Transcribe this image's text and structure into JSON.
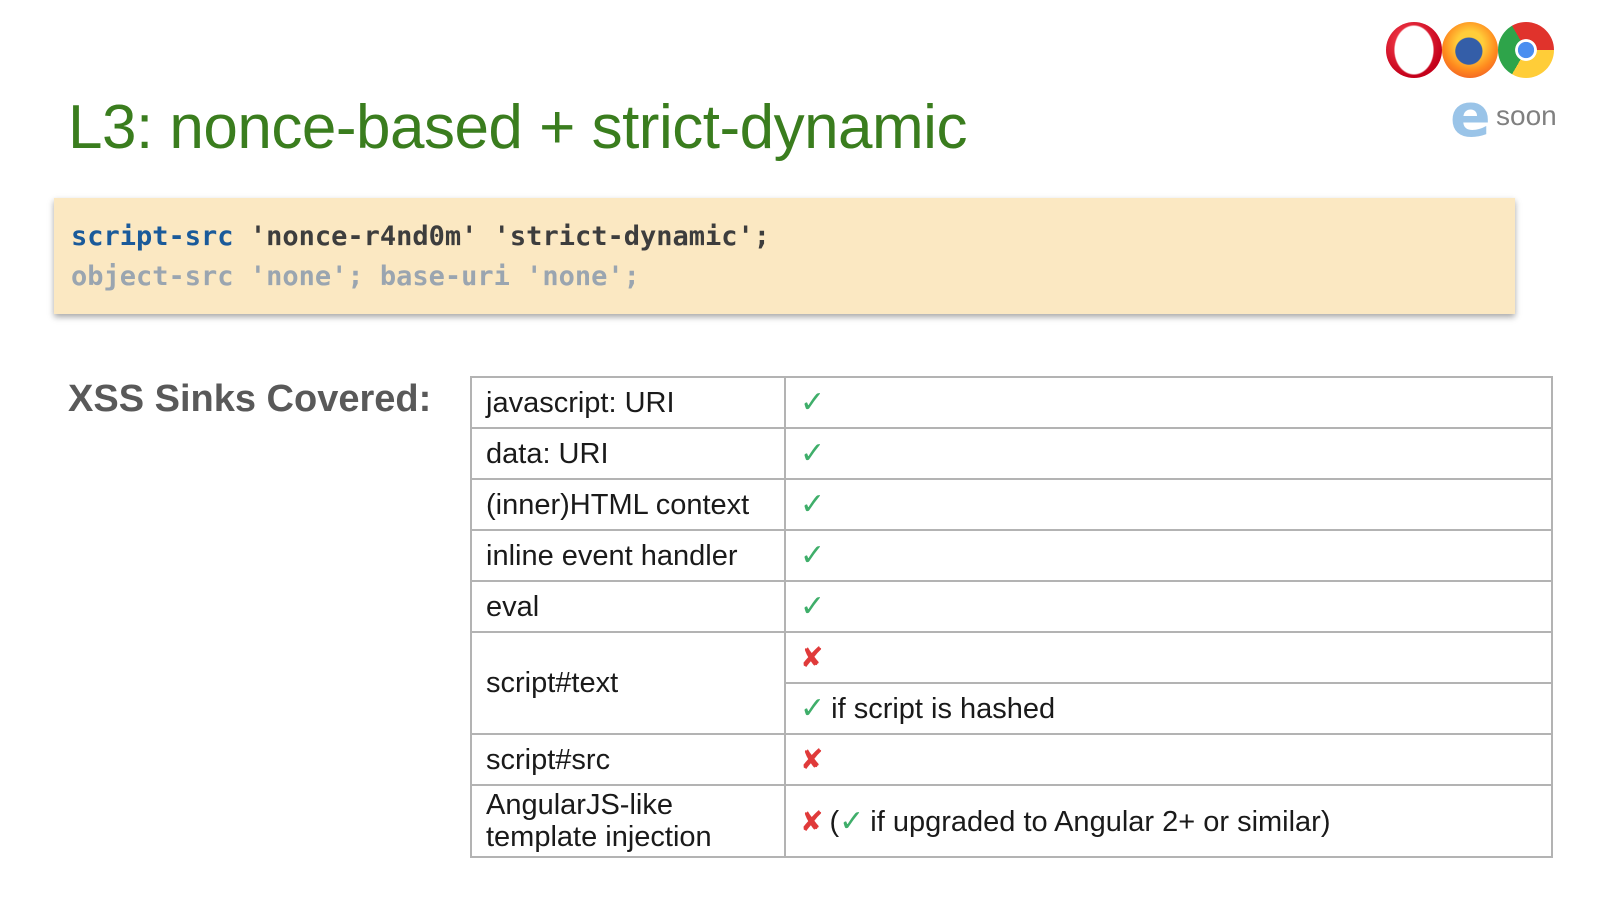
{
  "slide": {
    "title": "L3: nonce-based + strict-dynamic",
    "browsers": {
      "icons": [
        "opera-logo",
        "firefox-logo",
        "chrome-logo",
        "edge-logo"
      ],
      "edge_letter": "e",
      "edge_status": "soon"
    },
    "code": {
      "line1": {
        "directive": "script-src",
        "nonce": "'nonce-r4nd0m'",
        "strict": "'strict-dynamic'",
        "end": ";"
      },
      "line2": "object-src 'none'; base-uri 'none';"
    },
    "sinks_label": "XSS Sinks Covered:",
    "symbols": {
      "check": "✓",
      "cross": "✘"
    },
    "colors": {
      "title": "#3a7d1e",
      "check": "#3fae6a",
      "cross": "#e03a3a",
      "code_bg": "#fbe8c2"
    },
    "table": {
      "rows": [
        {
          "name": "javascript: URI",
          "status": "check"
        },
        {
          "name": "data: URI",
          "status": "check"
        },
        {
          "name": "(inner)HTML context",
          "status": "check"
        },
        {
          "name": "inline event handler",
          "status": "check"
        },
        {
          "name": "eval",
          "status": "check"
        },
        {
          "name": "script#text",
          "status": "cross",
          "alt_note": "if script is hashed"
        },
        {
          "name": "script#src",
          "status": "cross"
        },
        {
          "name_line1": "AngularJS-like",
          "name_line2": "template injection",
          "status": "cross",
          "note_open": "(",
          "note_text": "if upgraded to Angular 2+ or similar)"
        }
      ]
    }
  }
}
